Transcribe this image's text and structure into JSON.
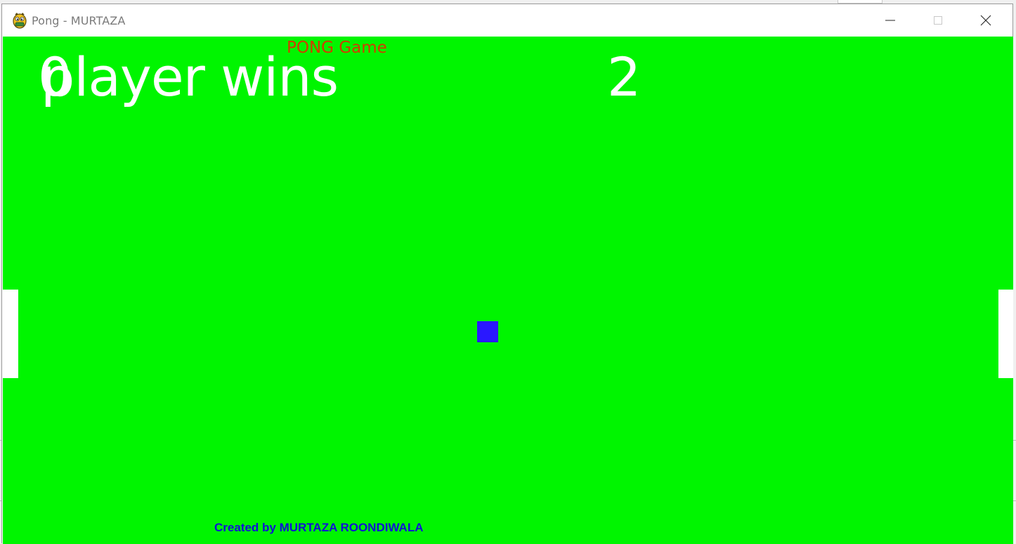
{
  "window": {
    "title": "Pong - MURTAZA",
    "controls": [
      "minimize",
      "maximize",
      "close"
    ],
    "icon": "pygame-snake-icon"
  },
  "game": {
    "title": "PONG Game",
    "left_score": "0",
    "right_score": "2",
    "win_message": "player wins",
    "credit": "Created by MURTAZA ROONDIWALA"
  },
  "colors": {
    "background": "#00f500",
    "title": "#d23c00",
    "score": "#ffffff",
    "paddle": "#ffffff",
    "ball": "#2a18ff",
    "credit": "#1010d8"
  }
}
